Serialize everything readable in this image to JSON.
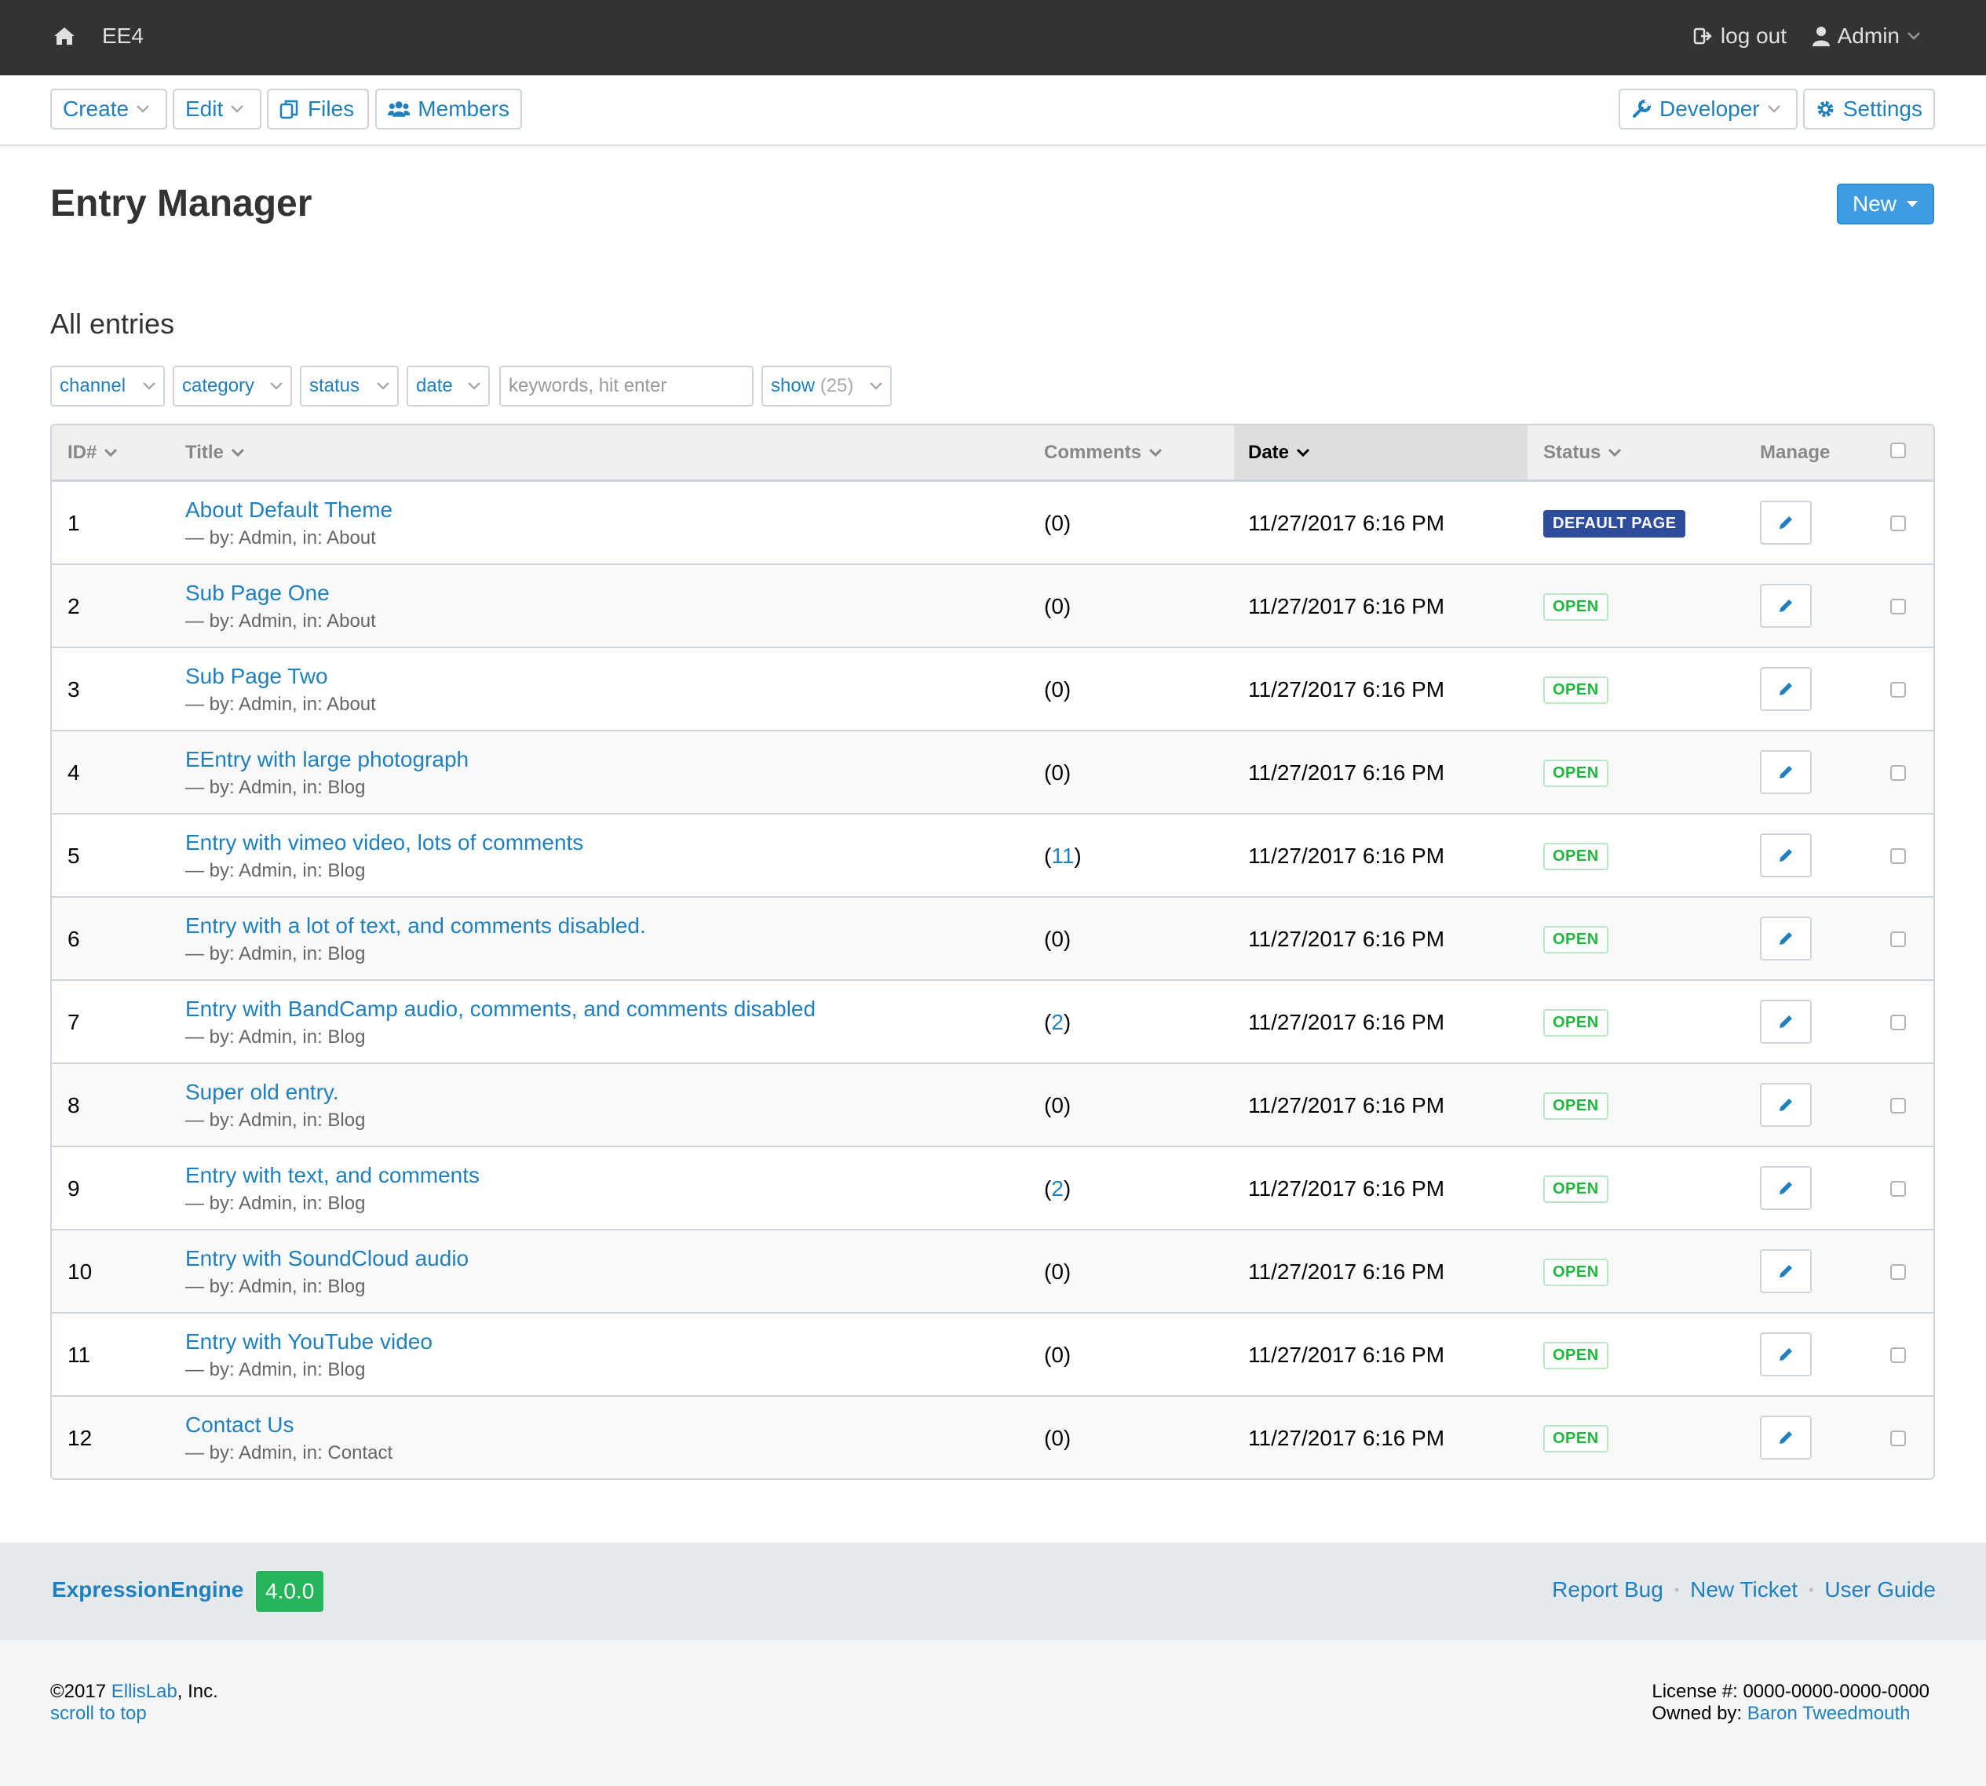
{
  "topbar": {
    "site_name": "EE4",
    "logout_label": "log out",
    "user_label": "Admin"
  },
  "nav": {
    "create": "Create",
    "edit": "Edit",
    "files": "Files",
    "members": "Members",
    "developer": "Developer",
    "settings": "Settings"
  },
  "page": {
    "title": "Entry Manager",
    "new_label": "New",
    "section_title": "All entries"
  },
  "filters": {
    "channel": "channel",
    "category": "category",
    "status": "status",
    "date": "date",
    "keyword_placeholder": "keywords, hit enter",
    "show_label": "show",
    "show_count": "(25)"
  },
  "table": {
    "headers": {
      "id": "ID#",
      "title": "Title",
      "comments": "Comments",
      "date": "Date",
      "status": "Status",
      "manage": "Manage"
    },
    "rows": [
      {
        "id": "1",
        "title": "About Default Theme",
        "meta": "— by: Admin, in: About",
        "comments_open": "(",
        "comments_count": "0",
        "comments_close": ")",
        "date": "11/27/2017 6:16 PM",
        "status": "DEFAULT PAGE"
      },
      {
        "id": "2",
        "title": "Sub Page One",
        "meta": "— by: Admin, in: About",
        "comments_open": "(",
        "comments_count": "0",
        "comments_close": ")",
        "date": "11/27/2017 6:16 PM",
        "status": "OPEN"
      },
      {
        "id": "3",
        "title": "Sub Page Two",
        "meta": "— by: Admin, in: About",
        "comments_open": "(",
        "comments_count": "0",
        "comments_close": ")",
        "date": "11/27/2017 6:16 PM",
        "status": "OPEN"
      },
      {
        "id": "4",
        "title": "EEntry with large photograph",
        "meta": "— by: Admin, in: Blog",
        "comments_open": "(",
        "comments_count": "0",
        "comments_close": ")",
        "date": "11/27/2017 6:16 PM",
        "status": "OPEN"
      },
      {
        "id": "5",
        "title": "Entry with vimeo video, lots of comments",
        "meta": "— by: Admin, in: Blog",
        "comments_open": "(",
        "comments_count": "11",
        "comments_close": ")",
        "date": "11/27/2017 6:16 PM",
        "status": "OPEN"
      },
      {
        "id": "6",
        "title": "Entry with a lot of text, and comments disabled.",
        "meta": "— by: Admin, in: Blog",
        "comments_open": "(",
        "comments_count": "0",
        "comments_close": ")",
        "date": "11/27/2017 6:16 PM",
        "status": "OPEN"
      },
      {
        "id": "7",
        "title": "Entry with BandCamp audio, comments, and comments disabled",
        "meta": "— by: Admin, in: Blog",
        "comments_open": "(",
        "comments_count": "2",
        "comments_close": ")",
        "date": "11/27/2017 6:16 PM",
        "status": "OPEN"
      },
      {
        "id": "8",
        "title": "Super old entry.",
        "meta": "— by: Admin, in: Blog",
        "comments_open": "(",
        "comments_count": "0",
        "comments_close": ")",
        "date": "11/27/2017 6:16 PM",
        "status": "OPEN"
      },
      {
        "id": "9",
        "title": "Entry with text, and comments",
        "meta": "— by: Admin, in: Blog",
        "comments_open": "(",
        "comments_count": "2",
        "comments_close": ")",
        "date": "11/27/2017 6:16 PM",
        "status": "OPEN"
      },
      {
        "id": "10",
        "title": "Entry with SoundCloud audio",
        "meta": "— by: Admin, in: Blog",
        "comments_open": "(",
        "comments_count": "0",
        "comments_close": ")",
        "date": "11/27/2017 6:16 PM",
        "status": "OPEN"
      },
      {
        "id": "11",
        "title": "Entry with YouTube video",
        "meta": "— by: Admin, in: Blog",
        "comments_open": "(",
        "comments_count": "0",
        "comments_close": ")",
        "date": "11/27/2017 6:16 PM",
        "status": "OPEN"
      },
      {
        "id": "12",
        "title": "Contact Us",
        "meta": "— by: Admin, in: Contact",
        "comments_open": "(",
        "comments_count": "0",
        "comments_close": ")",
        "date": "11/27/2017 6:16 PM",
        "status": "OPEN"
      }
    ]
  },
  "footer": {
    "brand": "ExpressionEngine",
    "version": "4.0.0",
    "report_bug": "Report Bug",
    "new_ticket": "New Ticket",
    "user_guide": "User Guide",
    "separator": "•",
    "copyright_prefix": "©2017",
    "company": "EllisLab",
    "copyright_suffix": ", Inc.",
    "scroll_to_top": "scroll to top",
    "license": "License #: 0000-0000-0000-0000",
    "owned_by_label": "Owned by:",
    "owner": "Baron Tweedmouth"
  },
  "colors": {
    "link": "#1f80bd",
    "topbar": "#333333",
    "primary_button": "#3d9ce2",
    "open_badge": "#1db83b",
    "default_badge": "#2e4c9c",
    "version_badge": "#27b55c"
  }
}
